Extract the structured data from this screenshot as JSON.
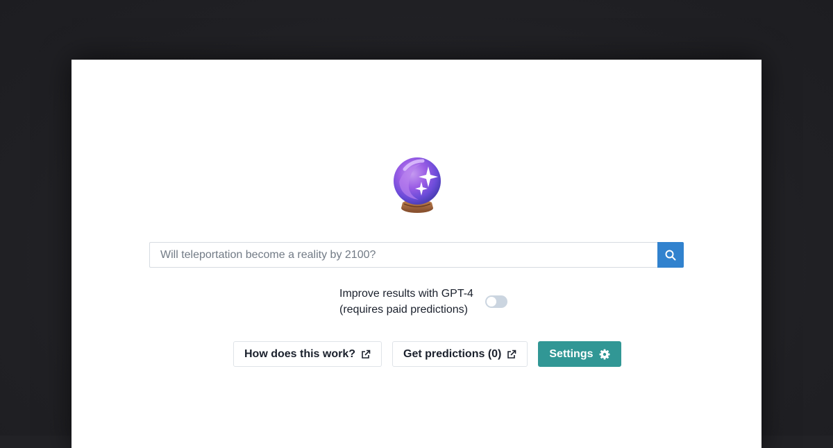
{
  "search": {
    "placeholder": "Will teleportation become a reality by 2100?",
    "button_icon": "search-icon"
  },
  "gpt_toggle": {
    "line1": "Improve results with GPT-4",
    "line2": "(requires paid predictions)",
    "enabled": false
  },
  "buttons": {
    "how_label": "How does this work?",
    "predictions_label": "Get predictions (0)",
    "settings_label": "Settings"
  },
  "logo_icon": "crystal-ball-icon",
  "colors": {
    "search_button": "#3182ce",
    "settings_button": "#319795",
    "toggle_off": "#cbd5e0"
  }
}
